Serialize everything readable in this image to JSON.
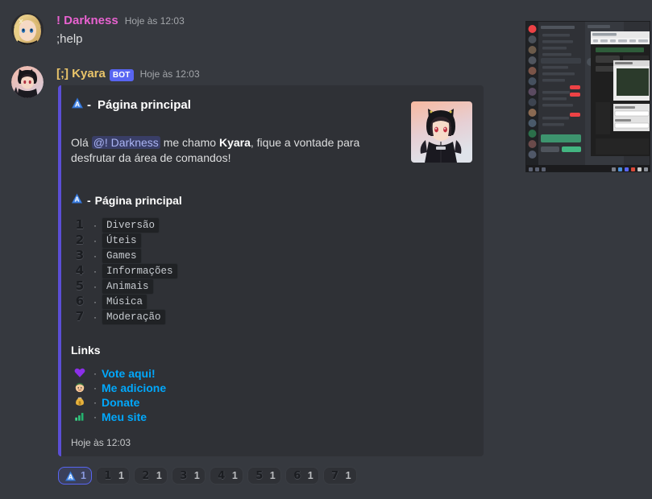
{
  "theme": {
    "page_bg": "#36393f",
    "embed_bg": "#2f3136",
    "embed_accent": "#5b4fd6",
    "link_color": "#00a8fc",
    "bot_badge_color": "#5865f2"
  },
  "messages": [
    {
      "author": "! Darkness",
      "author_color": "#e862d0",
      "is_bot": false,
      "timestamp": "Hoje às 12:03",
      "content": ";help"
    },
    {
      "author": "[;] Kyara",
      "author_color": "#e9c46a",
      "is_bot": true,
      "bot_label": "BOT",
      "timestamp": "Hoje às 12:03"
    }
  ],
  "embed": {
    "title_icon": "blue-triangle-a-emoji",
    "title_dash": "-",
    "title": "Página principal",
    "description_prefix": "Olá ",
    "mention": "@! Darkness",
    "description_mid": " me chamo ",
    "description_bold": "Kyara",
    "description_suffix": ", fique a vontade para desfrutar da área de comandos!",
    "field_icon": "blue-triangle-a-emoji",
    "field_dash": "-",
    "field_title": "Página principal",
    "commands": [
      {
        "emoji": "digit-one-emoji",
        "digit": "1",
        "bullet": "·",
        "label": "Diversão"
      },
      {
        "emoji": "digit-two-emoji",
        "digit": "2",
        "bullet": "·",
        "label": "Úteis"
      },
      {
        "emoji": "digit-three-emoji",
        "digit": "3",
        "bullet": "·",
        "label": "Games"
      },
      {
        "emoji": "digit-four-emoji",
        "digit": "4",
        "bullet": "·",
        "label": "Informações"
      },
      {
        "emoji": "digit-five-emoji",
        "digit": "5",
        "bullet": "·",
        "label": "Animais"
      },
      {
        "emoji": "digit-six-emoji",
        "digit": "6",
        "bullet": "·",
        "label": "Música"
      },
      {
        "emoji": "digit-seven-emoji",
        "digit": "7",
        "bullet": "·",
        "label": "Moderação"
      }
    ],
    "links_title": "Links",
    "links": [
      {
        "emoji": "purple-heart-emoji",
        "glyph": "💜",
        "bullet": "·",
        "label": "Vote aqui!"
      },
      {
        "emoji": "girl-face-emoji",
        "glyph": "👧",
        "bullet": "·",
        "label": "Me adicione"
      },
      {
        "emoji": "money-bag-emoji",
        "glyph": "💰",
        "bullet": "·",
        "label": "Donate"
      },
      {
        "emoji": "bar-chart-emoji",
        "glyph": "📊",
        "bullet": "·",
        "label": "Meu site"
      }
    ],
    "footer_timestamp": "Hoje às 12:03",
    "thumbnail": "anime-cat-hoodie-girl-thumbnail"
  },
  "reactions": [
    {
      "emoji": "blue-triangle-a-emoji",
      "digit": "A",
      "count": "1",
      "active": true
    },
    {
      "emoji": "digit-one-emoji",
      "digit": "1",
      "count": "1",
      "active": false
    },
    {
      "emoji": "digit-two-emoji",
      "digit": "2",
      "count": "1",
      "active": false
    },
    {
      "emoji": "digit-three-emoji",
      "digit": "3",
      "count": "1",
      "active": false
    },
    {
      "emoji": "digit-four-emoji",
      "digit": "4",
      "count": "1",
      "active": false
    },
    {
      "emoji": "digit-five-emoji",
      "digit": "5",
      "count": "1",
      "active": false
    },
    {
      "emoji": "digit-six-emoji",
      "digit": "6",
      "count": "1",
      "active": false
    },
    {
      "emoji": "digit-seven-emoji",
      "digit": "7",
      "count": "1",
      "active": false
    }
  ],
  "screenshot_thumbnail": {
    "name": "desktop-screenshot-discord-and-editor"
  }
}
